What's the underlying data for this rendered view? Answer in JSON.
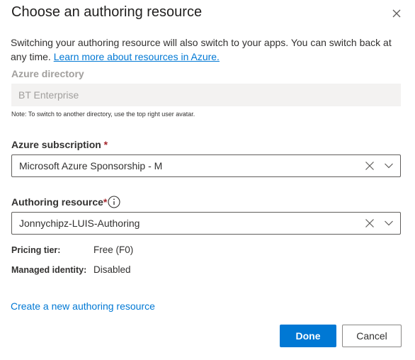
{
  "dialog": {
    "title": "Choose an authoring resource",
    "intro_text": "Switching your authoring resource will also switch to your apps. You can switch back at any time. ",
    "intro_link": "Learn more about resources in Azure.",
    "close_icon": "close-icon"
  },
  "directory": {
    "label": "Azure directory",
    "value": "BT Enterprise",
    "note": "Note: To switch to another directory, use the top right user avatar."
  },
  "subscription": {
    "label": "Azure subscription",
    "required_marker": " *",
    "value": "Microsoft Azure Sponsorship - M"
  },
  "authoring_resource": {
    "label": "Authoring resource",
    "required_marker": "*",
    "value": "Jonnychipz-LUIS-Authoring",
    "info_icon": "info-icon"
  },
  "details": {
    "pricing_tier_label": "Pricing tier:",
    "pricing_tier_value": "Free (F0)",
    "managed_identity_label": "Managed identity:",
    "managed_identity_value": "Disabled"
  },
  "create_link": "Create a new authoring resource",
  "buttons": {
    "done": "Done",
    "cancel": "Cancel"
  },
  "colors": {
    "accent": "#0078d4",
    "required": "#a4262c",
    "disabled_bg": "#f3f2f1"
  }
}
